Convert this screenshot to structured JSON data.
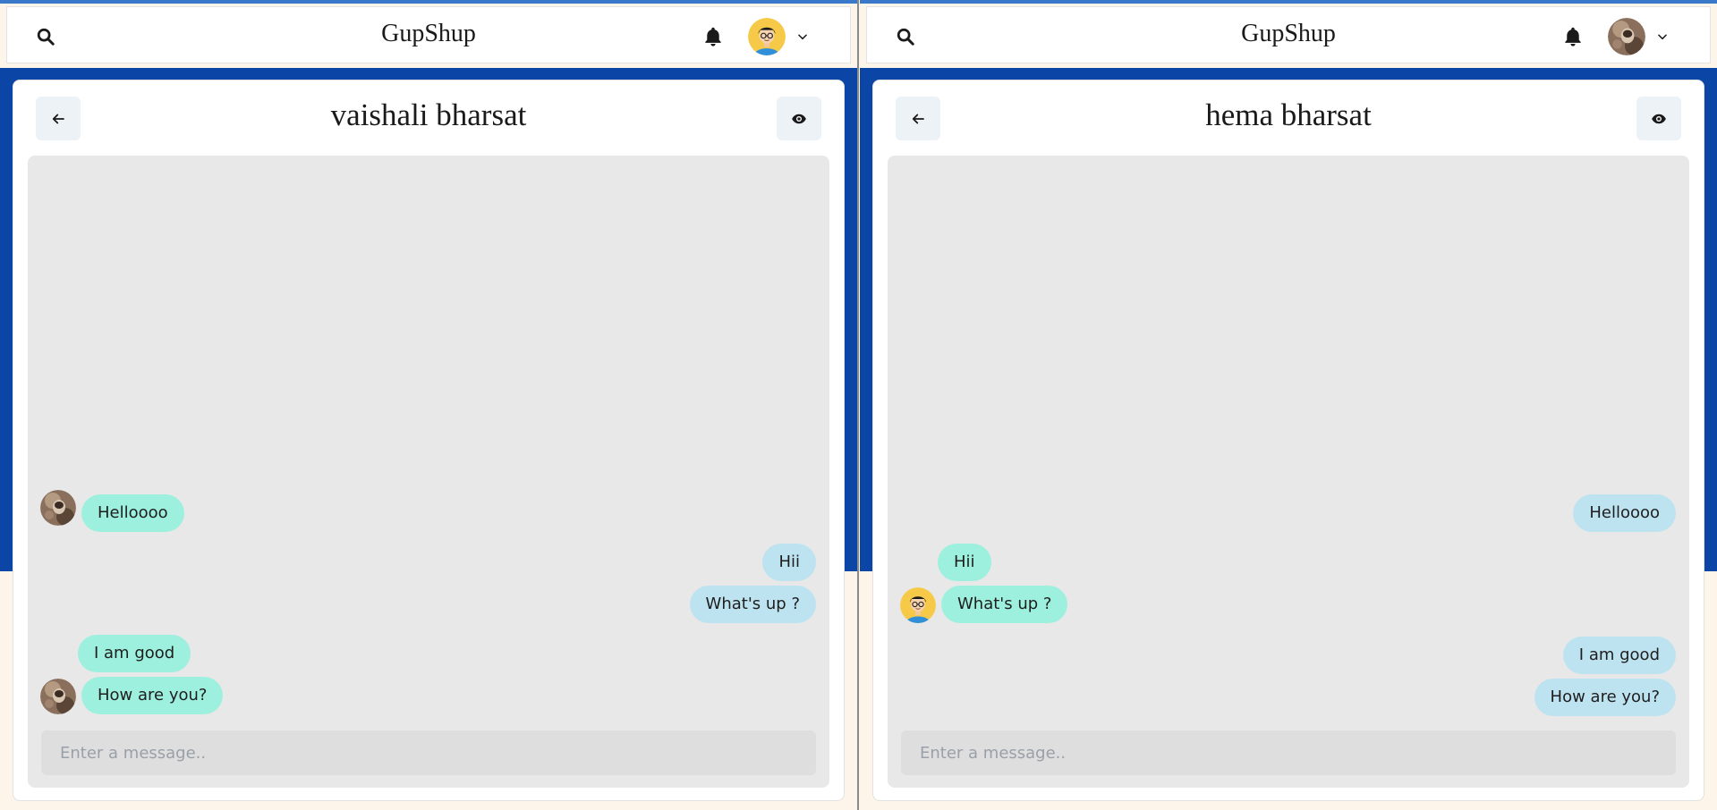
{
  "app": {
    "title": "GupShup"
  },
  "left": {
    "chat_name": "vaishali bharsat",
    "input_placeholder": "Enter a message..",
    "messages": [
      {
        "text": "Helloooo",
        "from": "theirs"
      },
      {
        "text": "Hii",
        "from": "mine"
      },
      {
        "text": "What's up ?",
        "from": "mine"
      },
      {
        "text": "I am good",
        "from": "theirs"
      },
      {
        "text": "How are you?",
        "from": "theirs"
      }
    ]
  },
  "right": {
    "chat_name": "hema bharsat",
    "input_placeholder": "Enter a message..",
    "messages": [
      {
        "text": "Helloooo",
        "from": "mine"
      },
      {
        "text": "Hii",
        "from": "theirs"
      },
      {
        "text": "What's up ?",
        "from": "theirs"
      },
      {
        "text": "I am good",
        "from": "mine"
      },
      {
        "text": "How are you?",
        "from": "mine"
      }
    ]
  },
  "colors": {
    "accent_band": "#0b45a6",
    "bubble_mine": "#bee3f0",
    "bubble_theirs": "#9ef0de",
    "chat_bg": "#e8e8e8"
  },
  "icons": {
    "search": "search-icon",
    "notifications": "bell-icon",
    "profile_menu": "chevron-down-icon",
    "back": "arrow-left-icon",
    "view_profile": "eye-icon"
  }
}
